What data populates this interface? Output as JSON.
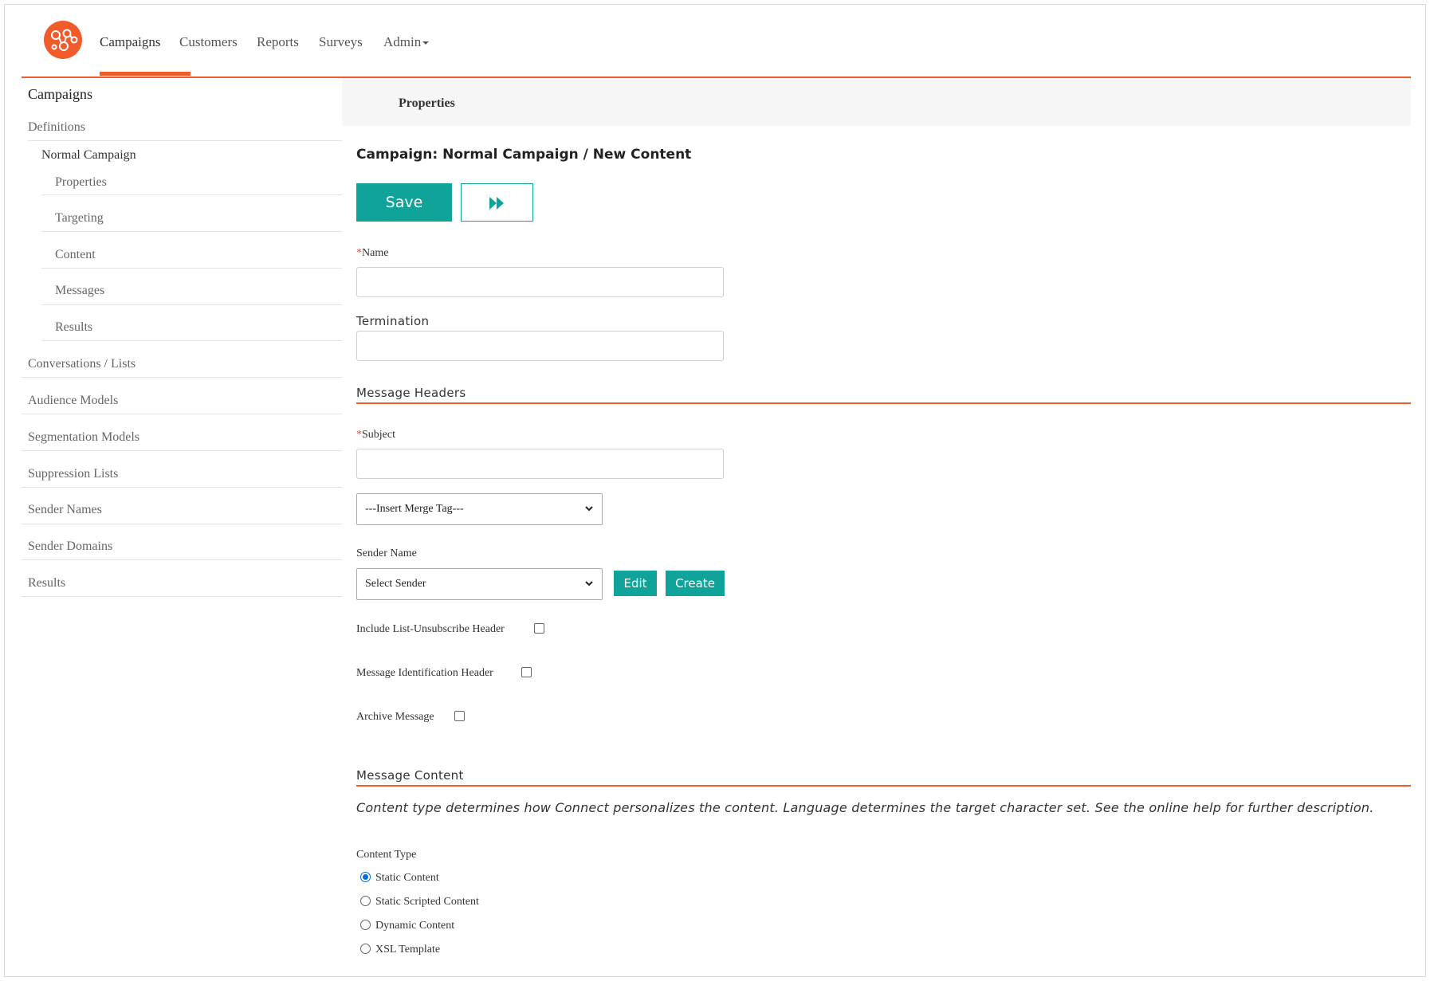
{
  "nav": {
    "items": [
      {
        "label": "Campaigns",
        "active": true
      },
      {
        "label": "Customers"
      },
      {
        "label": "Reports"
      },
      {
        "label": "Surveys"
      },
      {
        "label": "Admin"
      }
    ]
  },
  "sidebar": {
    "title": "Campaigns",
    "definitions": "Definitions",
    "campaign": "Normal Campaign",
    "sub_items": [
      "Properties",
      "Targeting",
      "Content",
      "Messages",
      "Results"
    ],
    "items": [
      "Conversations / Lists",
      "Audience Models",
      "Segmentation Models",
      "Suppression Lists",
      "Sender Names",
      "Sender Domains",
      "Results"
    ]
  },
  "main": {
    "tab_label": "Properties",
    "page_title": "Campaign: Normal Campaign / New Content",
    "save_label": "Save",
    "name_label": "Name",
    "name_value": "",
    "termination_label": "Termination",
    "termination_value": "",
    "headers_section": "Message Headers",
    "subject_label": "Subject",
    "subject_value": "",
    "merge_tag_selected": "---Insert Merge Tag---",
    "sender_name_label": "Sender Name",
    "sender_selected": "Select Sender",
    "edit_label": "Edit",
    "create_label": "Create",
    "checkboxes": [
      {
        "label": "Include List-Unsubscribe Header",
        "checked": false
      },
      {
        "label": "Message Identification Header",
        "checked": false
      },
      {
        "label": "Archive Message",
        "checked": false
      }
    ],
    "content_section": "Message Content",
    "help_text": "Content type determines how Connect personalizes the content. Language determines the target character set. See the online help for further description.",
    "content_type_label": "Content Type",
    "content_types": [
      {
        "label": "Static Content",
        "selected": true
      },
      {
        "label": "Static Scripted Content",
        "selected": false
      },
      {
        "label": "Dynamic Content",
        "selected": false
      },
      {
        "label": "XSL Template",
        "selected": false
      }
    ]
  },
  "colors": {
    "brand_orange": "#f15a29",
    "teal": "#10a39a"
  },
  "icons": [
    "logo-icon",
    "fast-forward-icon",
    "chevron-down-icon",
    "caret-down-icon"
  ]
}
